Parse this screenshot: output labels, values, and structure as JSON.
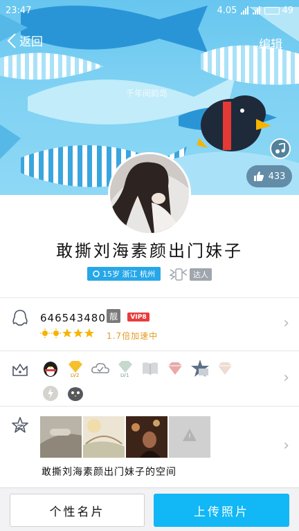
{
  "status_bar": {
    "time": "23:47",
    "net_speed": "4.05",
    "battery": "49",
    "battery_fraction": 0.49
  },
  "nav": {
    "back_label": "返回",
    "edit_label": "编辑"
  },
  "cover": {
    "watermark": "千年阅韵岛",
    "like_count": "433"
  },
  "profile": {
    "nickname": "敢撕刘海素颜出门妹子",
    "info_tag": "15岁 浙江 杭州",
    "talent_label": "达人"
  },
  "qq_row": {
    "qq_number": "646543480",
    "liang_badge": "靓",
    "vip_badge": "VIP8",
    "speed_text": "1.7倍加速中",
    "level_icons": [
      "sun-icon",
      "sun-icon",
      "star-icon",
      "star-icon",
      "star-icon"
    ]
  },
  "badge_row": {
    "icons": [
      "qq-penguin-icon",
      "yellow-diamond-icon",
      "cloud-icon",
      "green-diamond-icon",
      "book-icon",
      "pink-diamond-icon",
      "star-badge-icon",
      "pale-diamond-icon",
      "lightning-icon",
      "penguin-face-icon"
    ],
    "level_labels": {
      "yellow_diamond": "LV2",
      "green_diamond": "LV1"
    }
  },
  "space_row": {
    "label": "敢撕刘海素颜出门妹子的空间"
  },
  "bottom_bar": {
    "card_label": "个性名片",
    "upload_label": "上传照片"
  },
  "colors": {
    "accent": "#12b7f5",
    "tag": "#27a7e8",
    "vip": "#e73d3d",
    "gold_text": "#e19a20"
  }
}
